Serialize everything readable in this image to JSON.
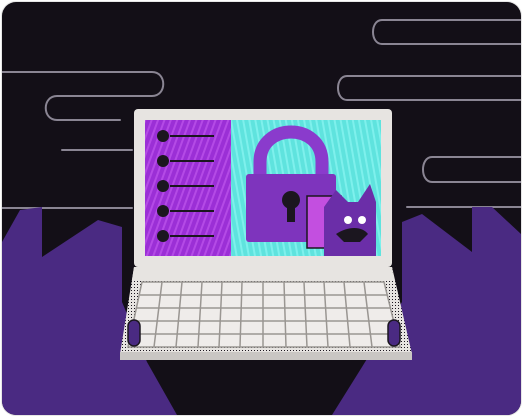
{
  "illustration": {
    "subject": "laptop-security-illustration",
    "colors": {
      "background": "#130f17",
      "lines": "#8a8593",
      "hands": "#4a2a82",
      "hands_shadow": "#2c1a52",
      "laptop_body": "#e7e4e1",
      "laptop_shadow": "#1b161f",
      "screen_left": "#9b2fd6",
      "screen_right": "#5fe3de",
      "padlock": "#8a3bcc",
      "padlock_dark": "#5b1f8f",
      "creature": "#6b2ea8",
      "keyboard_grid": "#9a9692"
    },
    "icons": [
      "padlock-icon",
      "cat-creature-icon",
      "list-bullets-icon"
    ]
  }
}
